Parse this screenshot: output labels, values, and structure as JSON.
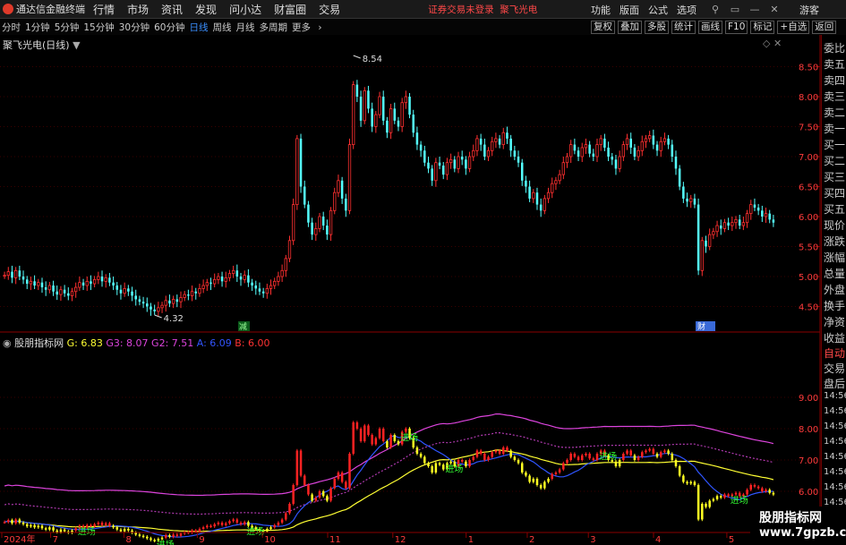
{
  "app": {
    "title": "通达信金融终端"
  },
  "menu": [
    "行情",
    "市场",
    "资讯",
    "发现",
    "问小达",
    "财富圈",
    "交易"
  ],
  "login_status": "证券交易未登录",
  "stock_name": "聚飞光电",
  "right_menu": [
    "功能",
    "版面",
    "公式",
    "选项"
  ],
  "user": "游客",
  "periods": [
    "分时",
    "1分钟",
    "5分钟",
    "15分钟",
    "30分钟",
    "60分钟",
    "日线",
    "周线",
    "月线",
    "多周期",
    "更多"
  ],
  "active_period": "日线",
  "tools": [
    "复权",
    "叠加",
    "多股",
    "统计",
    "画线",
    "F10",
    "标记",
    "+自选",
    "返回"
  ],
  "main_chart": {
    "title": "聚飞光电(日线)",
    "y_ticks": [
      "8.50",
      "8.00",
      "7.50",
      "7.00",
      "6.50",
      "6.00",
      "5.50",
      "5.00",
      "4.50"
    ],
    "high_label": "8.54",
    "low_label": "4.32",
    "markers": {
      "jian": "减",
      "cai": "财"
    }
  },
  "indicator": {
    "name": "股朋指标网",
    "values": [
      {
        "label": "G: 6.83",
        "color": "#ffff33"
      },
      {
        "label": "G3: 8.07",
        "color": "#dd44dd"
      },
      {
        "label": "G2: 7.51",
        "color": "#dd44dd"
      },
      {
        "label": "A: 6.09",
        "color": "#3355ff"
      },
      {
        "label": "B: 6.00",
        "color": "#ff3333"
      }
    ],
    "y_ticks": [
      "9.00",
      "8.00",
      "7.00",
      "6.00"
    ],
    "entry_label": "进场"
  },
  "x_axis": {
    "labels": [
      {
        "text": "2024年",
        "pos": 0.0
      },
      {
        "text": "7",
        "pos": 0.06
      },
      {
        "text": "8",
        "pos": 0.15
      },
      {
        "text": "9",
        "pos": 0.24
      },
      {
        "text": "10",
        "pos": 0.32
      },
      {
        "text": "11",
        "pos": 0.4
      },
      {
        "text": "12",
        "pos": 0.48
      },
      {
        "text": "1",
        "pos": 0.57
      },
      {
        "text": "2",
        "pos": 0.645
      },
      {
        "text": "3",
        "pos": 0.72
      },
      {
        "text": "4",
        "pos": 0.8
      },
      {
        "text": "5",
        "pos": 0.89
      }
    ]
  },
  "right_panel": {
    "quote_items": [
      "委比",
      "卖五",
      "卖四",
      "卖三",
      "卖二",
      "卖一",
      "买一",
      "买二",
      "买三",
      "买四",
      "买五",
      "现价",
      "涨跌",
      "涨幅",
      "总量",
      "外盘",
      "换手",
      "净资",
      "收益"
    ],
    "auto_label": "自动",
    "trade_items": [
      "交易",
      "盘后"
    ],
    "times": [
      "14:56",
      "14:56",
      "14:56",
      "14:56",
      "14:56",
      "14:56",
      "14:56",
      "14:56"
    ]
  },
  "watermark": {
    "line1": "股朋指标网",
    "line2": "www.7gpzb.com"
  },
  "chart_data": {
    "type": "candlestick",
    "closes": [
      5.02,
      5.08,
      4.98,
      5.1,
      5.0,
      4.95,
      4.88,
      4.92,
      4.85,
      4.9,
      4.82,
      4.78,
      4.85,
      4.75,
      4.7,
      4.78,
      4.72,
      4.68,
      4.75,
      4.82,
      4.9,
      4.85,
      4.92,
      4.88,
      4.95,
      5.0,
      4.92,
      4.98,
      4.9,
      4.85,
      4.78,
      4.72,
      4.8,
      4.75,
      4.68,
      4.62,
      4.58,
      4.55,
      4.5,
      4.45,
      4.42,
      4.48,
      4.52,
      4.6,
      4.55,
      4.62,
      4.58,
      4.65,
      4.7,
      4.68,
      4.75,
      4.72,
      4.8,
      4.85,
      4.9,
      4.88,
      4.95,
      5.0,
      4.92,
      4.98,
      5.05,
      5.1,
      5.0,
      4.95,
      5.02,
      4.9,
      4.85,
      4.8,
      4.75,
      4.72,
      4.8,
      4.85,
      4.92,
      5.0,
      5.1,
      5.3,
      5.6,
      6.2,
      7.3,
      6.5,
      6.2,
      5.9,
      5.7,
      5.8,
      6.0,
      5.85,
      5.7,
      6.1,
      6.4,
      6.6,
      6.3,
      6.1,
      7.2,
      8.2,
      8.0,
      7.6,
      8.1,
      7.8,
      7.5,
      7.7,
      8.0,
      7.6,
      7.4,
      7.8,
      7.6,
      7.5,
      7.9,
      8.0,
      7.7,
      7.4,
      7.2,
      7.1,
      6.9,
      6.8,
      6.6,
      6.9,
      6.85,
      6.7,
      6.9,
      6.95,
      6.8,
      7.0,
      6.95,
      6.8,
      7.0,
      7.1,
      7.3,
      7.2,
      7.0,
      7.1,
      7.25,
      7.3,
      7.2,
      7.4,
      7.3,
      7.1,
      7.0,
      6.9,
      6.6,
      6.5,
      6.3,
      6.4,
      6.2,
      6.1,
      6.3,
      6.4,
      6.55,
      6.6,
      6.7,
      6.9,
      7.0,
      7.2,
      7.1,
      7.0,
      7.15,
      7.2,
      7.05,
      7.0,
      7.2,
      7.3,
      7.15,
      7.0,
      6.95,
      6.8,
      7.0,
      7.2,
      7.3,
      7.15,
      7.0,
      7.1,
      7.25,
      7.3,
      7.35,
      7.2,
      7.1,
      7.25,
      7.3,
      7.2,
      7.0,
      6.8,
      6.5,
      6.3,
      6.25,
      6.3,
      6.2,
      5.1,
      5.6,
      5.5,
      5.7,
      5.75,
      5.85,
      5.8,
      5.9,
      5.85,
      5.9,
      5.95,
      5.85,
      5.9,
      6.05,
      6.2,
      6.15,
      6.1,
      6.0,
      6.05,
      5.95,
      5.9
    ]
  }
}
